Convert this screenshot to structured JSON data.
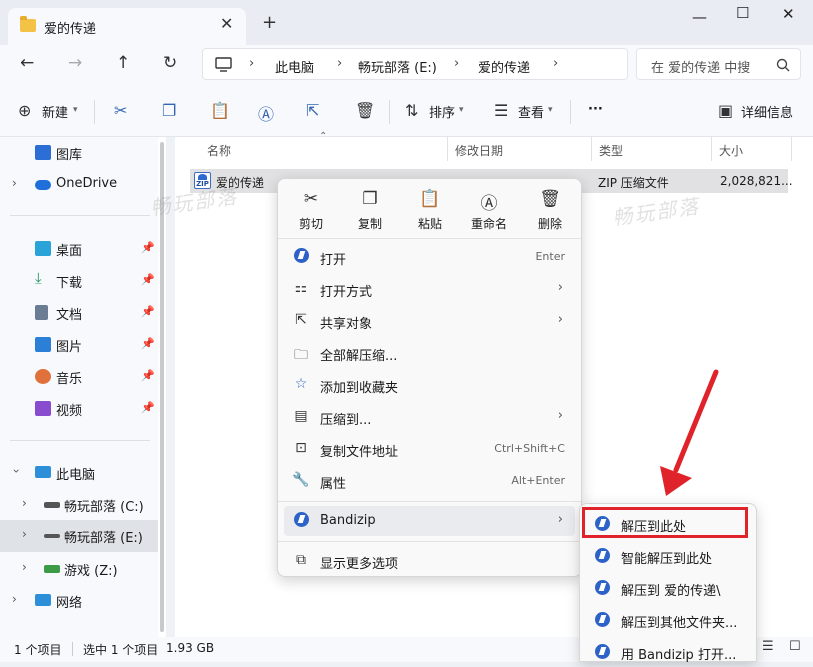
{
  "window": {
    "tab_title": "爱的传递",
    "tab_close": "✕",
    "tab_add": "+",
    "controls": {
      "minimize": "—",
      "maximize": "☐",
      "close": "✕"
    }
  },
  "nav": {
    "back": "←",
    "forward": "→",
    "up": "↑",
    "refresh": "↻",
    "breadcrumb": [
      "此电脑",
      "畅玩部落 (E:)",
      "爱的传递"
    ],
    "search_placeholder": "在 爱的传递 中搜"
  },
  "toolbar": {
    "new_label": "新建",
    "sort_label": "排序",
    "view_label": "查看",
    "more_label": "···",
    "details_label": "详细信息"
  },
  "sidebar": {
    "items": [
      {
        "label": "图库",
        "icon": "gallery-icon",
        "color": "#2b6fd6"
      },
      {
        "label": "OneDrive",
        "icon": "cloud-icon",
        "color": "#1e6fd9"
      },
      {
        "label": "桌面",
        "icon": "desktop-icon",
        "color": "#2aa3d8"
      },
      {
        "label": "下载",
        "icon": "download-icon",
        "color": "#1f9a62"
      },
      {
        "label": "文档",
        "icon": "document-icon",
        "color": "#6b7d92"
      },
      {
        "label": "图片",
        "icon": "picture-icon",
        "color": "#2b7fd6"
      },
      {
        "label": "音乐",
        "icon": "music-icon",
        "color": "#e0713a"
      },
      {
        "label": "视频",
        "icon": "video-icon",
        "color": "#8a4ccf"
      },
      {
        "label": "此电脑",
        "icon": "computer-icon",
        "color": "#2d8fd8"
      },
      {
        "label": "畅玩部落 (C:)",
        "icon": "drive-icon",
        "color": "#555555"
      },
      {
        "label": "畅玩部落 (E:)",
        "icon": "drive-icon",
        "color": "#555555"
      },
      {
        "label": "游戏 (Z:)",
        "icon": "drive-icon",
        "color": "#3b9b46"
      },
      {
        "label": "网络",
        "icon": "network-icon",
        "color": "#2d8fd8"
      }
    ]
  },
  "columns": {
    "name": "名称",
    "modified": "修改日期",
    "type": "类型",
    "size": "大小"
  },
  "file": {
    "name": "爱的传递",
    "type": "ZIP 压缩文件",
    "size": "2,028,821..."
  },
  "watermark": "畅玩部落",
  "status": {
    "count": "1 个项目",
    "selected": "选中 1 个项目",
    "size": "1.93 GB"
  },
  "context_menu": {
    "quick": [
      "剪切",
      "复制",
      "粘贴",
      "重命名",
      "删除"
    ],
    "items": [
      {
        "label": "打开",
        "shortcut": "Enter",
        "submenu": false
      },
      {
        "label": "打开方式",
        "shortcut": "",
        "submenu": true
      },
      {
        "label": "共享对象",
        "shortcut": "",
        "submenu": true
      },
      {
        "label": "全部解压缩...",
        "shortcut": "",
        "submenu": false
      },
      {
        "label": "添加到收藏夹",
        "shortcut": "",
        "submenu": false
      },
      {
        "label": "压缩到...",
        "shortcut": "",
        "submenu": true
      },
      {
        "label": "复制文件地址",
        "shortcut": "Ctrl+Shift+C",
        "submenu": false
      },
      {
        "label": "属性",
        "shortcut": "Alt+Enter",
        "submenu": false
      },
      {
        "label": "Bandizip",
        "shortcut": "",
        "submenu": true
      },
      {
        "label": "显示更多选项",
        "shortcut": "",
        "submenu": false
      }
    ]
  },
  "bandizip_submenu": [
    "解压到此处",
    "智能解压到此处",
    "解压到 爱的传递\\",
    "解压到其他文件夹...",
    "用 Bandizip 打开..."
  ],
  "highlight_color": "#e0232a"
}
